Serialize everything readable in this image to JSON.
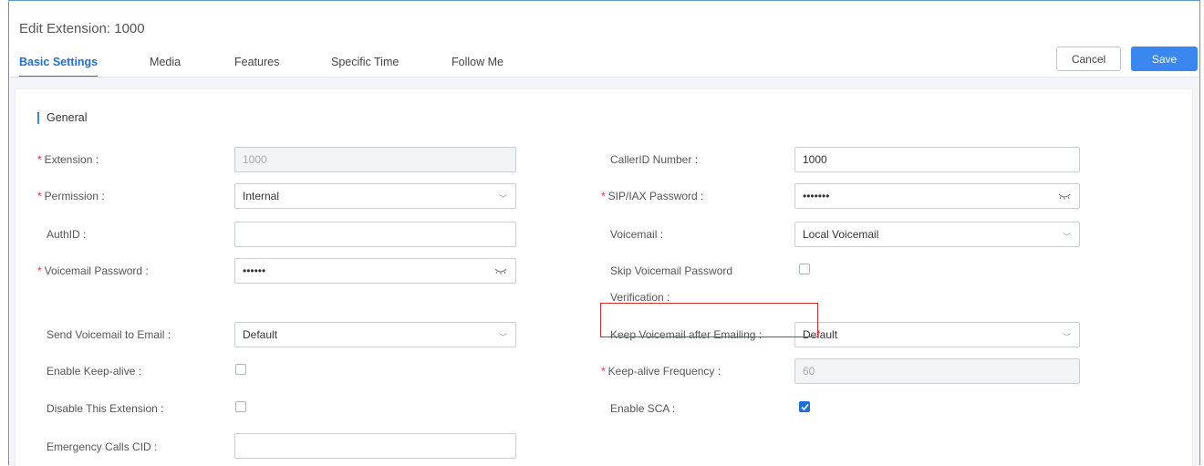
{
  "header": {
    "title": "Edit Extension: 1000",
    "cancel_label": "Cancel",
    "save_label": "Save"
  },
  "tabs": [
    {
      "label": "Basic Settings",
      "active": true
    },
    {
      "label": "Media"
    },
    {
      "label": "Features"
    },
    {
      "label": "Specific Time"
    },
    {
      "label": "Follow Me"
    }
  ],
  "section": {
    "title": "General"
  },
  "left": {
    "extension": {
      "label": "Extension :",
      "value": "1000",
      "required": true
    },
    "permission": {
      "label": "Permission :",
      "value": "Internal",
      "required": true
    },
    "authid": {
      "label": "AuthID :",
      "value": ""
    },
    "voicemail_password": {
      "label": "Voicemail Password :",
      "value": "••••••",
      "required": true
    },
    "send_voicemail_email": {
      "label": "Send Voicemail to Email :",
      "value": "Default"
    },
    "enable_keepalive": {
      "label": "Enable Keep-alive :",
      "checked": false
    },
    "disable_extension": {
      "label": "Disable This Extension :",
      "checked": false
    },
    "emergency_cid": {
      "label": "Emergency Calls CID :",
      "value": ""
    }
  },
  "right": {
    "callerid": {
      "label": "CallerID Number :",
      "value": "1000"
    },
    "sip_password": {
      "label": "SIP/IAX Password :",
      "value": "•••••••",
      "required": true
    },
    "voicemail": {
      "label": "Voicemail :",
      "value": "Local Voicemail"
    },
    "skip_vm_verification": {
      "label_line1": "Skip Voicemail Password",
      "label_line2": "Verification :",
      "checked": false
    },
    "keep_vm": {
      "label": "Keep Voicemail after Emailing :",
      "value": "Default"
    },
    "keepalive_freq": {
      "label": "Keep-alive Frequency :",
      "value": "60",
      "required": true
    },
    "enable_sca": {
      "label": "Enable SCA :",
      "checked": true
    }
  },
  "colors": {
    "accent": "#1e6fd9",
    "save_button": "#3a87f0",
    "required": "#e53935",
    "highlight_box": "#d32f2f"
  },
  "icons": {
    "eye": "eye-hidden-icon",
    "chevron": "chevron-down-icon",
    "check": "check-icon"
  }
}
